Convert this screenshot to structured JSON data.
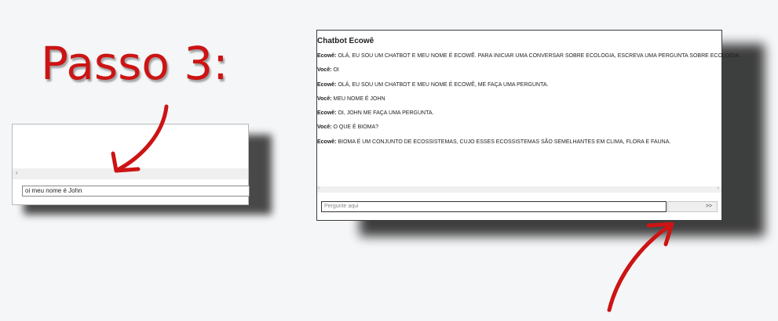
{
  "step": {
    "title": "Passo 3:"
  },
  "left_window": {
    "input_value": "oi meu nome é John"
  },
  "chat": {
    "title": "Chatbot Ecowê",
    "messages": [
      {
        "speaker": "Ecowê:",
        "text": " OLÁ, EU SOU UM CHATBOT E MEU NOME É ECOWÊ. PARA INICIAR UMA CONVERSAR SOBRE ECOLOGIA, ESCREVA UMA PERGUNTA SOBRE ECOLOGIA."
      },
      {
        "speaker": "Você:",
        "text": " OI"
      },
      {
        "speaker": "Ecowê:",
        "text": " OLÁ, EU SOU UM CHATBOT E MEU NOME É ECOWÊ, ME FAÇA UMA PERGUNTA."
      },
      {
        "speaker": "Você:",
        "text": " MEU NOME É JOHN"
      },
      {
        "speaker": "Ecowê:",
        "text": " OI, JOHN ME FAÇA UMA PERGUNTA."
      },
      {
        "speaker": "Você:",
        "text": " O QUE É BIOMA?"
      },
      {
        "speaker": "Ecowê:",
        "text": " BIOMA É UM CONJUNTO DE ECOSSISTEMAS, CUJO ESSES ECOSSISTEMAS SÃO SEMELHANTES EM CLIMA, FLORA E FAUNA."
      }
    ],
    "input_placeholder": "Pergunte aqui",
    "send_label": ">>"
  },
  "colors": {
    "annotation_red": "#cc1414"
  },
  "icons": {
    "annotation_arrow": "curved-arrow-icon"
  }
}
